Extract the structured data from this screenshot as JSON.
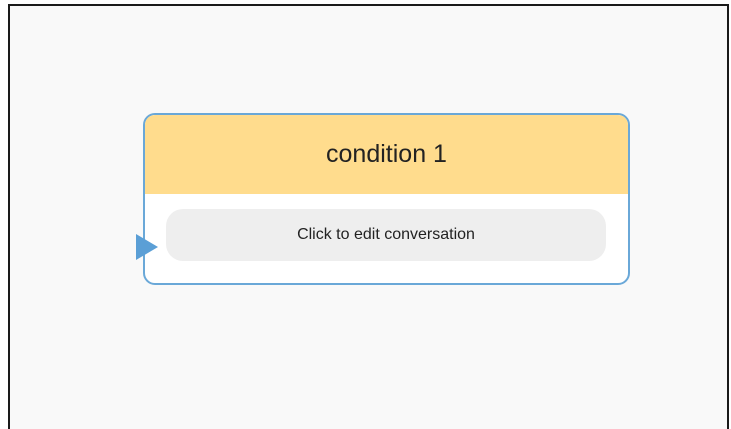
{
  "canvas": {
    "background_color": "#f9f9f9"
  },
  "node": {
    "title": "condition 1",
    "header_color": "#ffdc8d",
    "border_color": "#6aa8d8",
    "action_label": "Click to edit conversation",
    "port_icon": "triangle-right-icon",
    "port_color": "#5b9fd6"
  }
}
